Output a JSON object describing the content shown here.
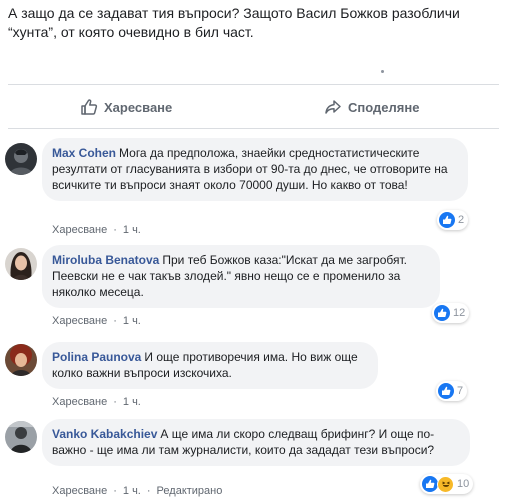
{
  "post": {
    "text_line1": "А защо да се задават тия въпроси? Защото Васил Божков разобличи",
    "text_line2": "“хунта”, от която очевидно в бил част."
  },
  "actions": {
    "like_label": "Харесване",
    "share_label": "Споделяне"
  },
  "colors": {
    "author_link": "#385898",
    "bubble_bg": "#f2f3f5",
    "like_blue": "#1877f2",
    "meta_gray": "#606770"
  },
  "comments": [
    {
      "author": "Max Cohen",
      "text": "Мога да предположа, знаейки средностатистическите резултати от гласуванията в избори от 90-та до днес, че отговорите на всичките ти въпроси знаят около 70000 души. Но какво от това!",
      "like_label": "Харесване",
      "time": "1 ч.",
      "reaction_count": "2"
    },
    {
      "author": "Miroluba Benatova",
      "text": "При теб Божков каза:\"Искат да ме загробят. Пеевски не е чак такъв злодей.\" явно нещо се е променило за няколко месеца.",
      "like_label": "Харесване",
      "time": "1 ч.",
      "reaction_count": "12"
    },
    {
      "author": "Polina Paunova",
      "text": "И още противоречия има. Но виж още колко важни въпроси изскочиха.",
      "like_label": "Харесване",
      "time": "1 ч.",
      "reaction_count": "7"
    },
    {
      "author": "Vanko Kabakchiev",
      "text": "А ще има ли скоро следващ брифинг? И още по-важно - ще има ли там журналисти, които да зададат тези въпроси?",
      "like_label": "Харесване",
      "time": "1 ч.",
      "edited": "Редактирано",
      "reaction_count": "10"
    }
  ]
}
